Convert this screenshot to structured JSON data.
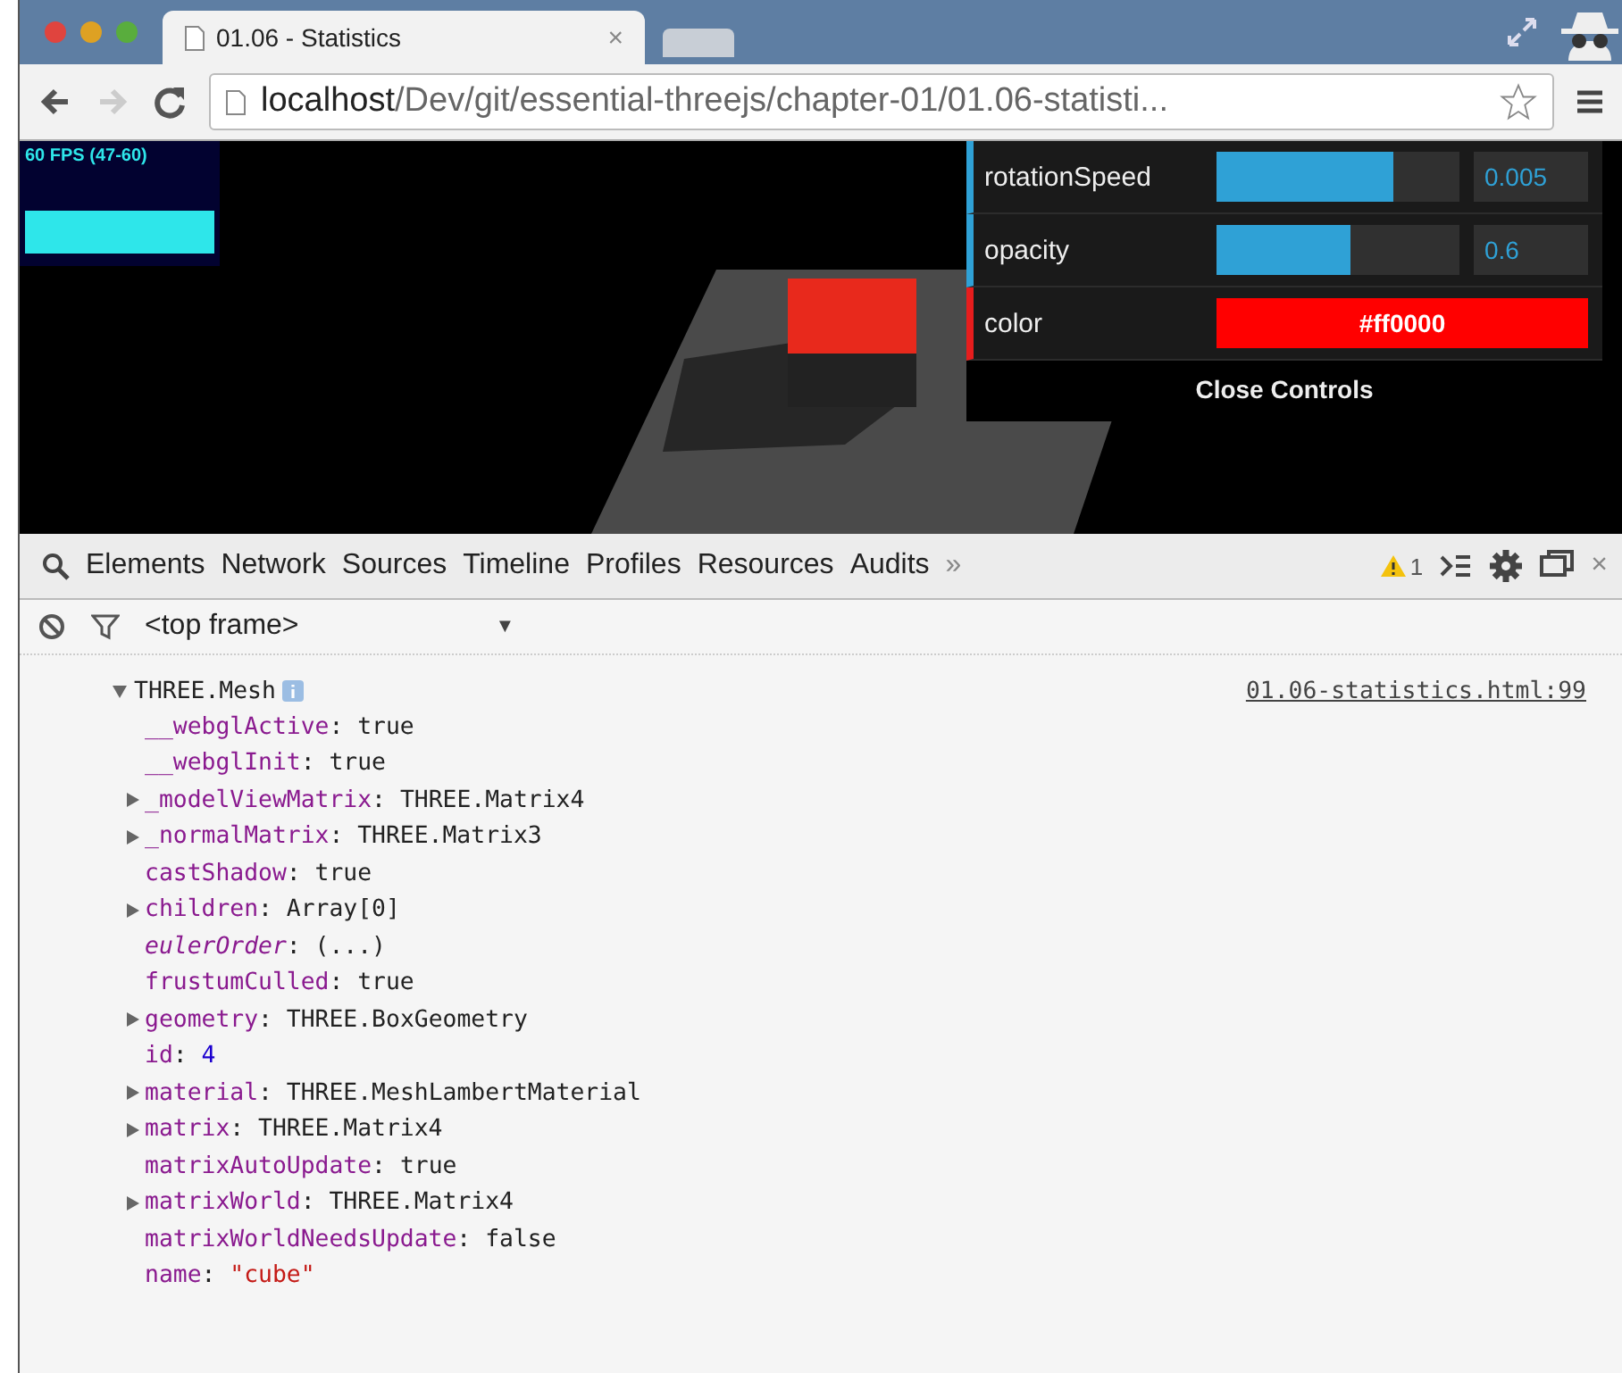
{
  "browser": {
    "tab": {
      "title": "01.06 - Statistics",
      "close": "×"
    },
    "address": {
      "host": "localhost",
      "path": "/Dev/git/essential-threejs/chapter-01/01.06-statisti..."
    }
  },
  "stats": {
    "fps": "60 FPS (47-60)"
  },
  "controls": {
    "rows": [
      {
        "kind": "slider",
        "label": "rotationSpeed",
        "level": 0.73,
        "value": "0.005"
      },
      {
        "kind": "slider",
        "label": "opacity",
        "level": 0.55,
        "value": "0.6"
      },
      {
        "kind": "color",
        "label": "color",
        "value": "#ff0000",
        "color": "#ff0000"
      }
    ],
    "close": "Close Controls"
  },
  "devtools": {
    "tabs": [
      {
        "label": "Elements",
        "selected": false
      },
      {
        "label": "Network",
        "selected": false
      },
      {
        "label": "Sources",
        "selected": false
      },
      {
        "label": "Timeline",
        "selected": false
      },
      {
        "label": "Profiles",
        "selected": false
      },
      {
        "label": "Resources",
        "selected": false
      },
      {
        "label": "Audits",
        "selected": false
      }
    ],
    "more": "»",
    "warnings": "1",
    "close": "×",
    "frame": {
      "label": "<top frame>",
      "arrow": "▼"
    },
    "console": {
      "object": "THREE.Mesh",
      "source": "01.06-statistics.html:99",
      "expanded": true,
      "properties": [
        {
          "name": "__webglActive",
          "separator": ":",
          "value": "true",
          "kind": "plain",
          "expandable": false
        },
        {
          "name": "__webglInit",
          "separator": ":",
          "value": "true",
          "kind": "plain",
          "expandable": false
        },
        {
          "name": "_modelViewMatrix",
          "separator": ":",
          "value": "THREE.Matrix4",
          "kind": "plain",
          "expandable": true
        },
        {
          "name": "_normalMatrix",
          "separator": ":",
          "value": "THREE.Matrix3",
          "kind": "plain",
          "expandable": true
        },
        {
          "name": "castShadow",
          "separator": ":",
          "value": "true",
          "kind": "plain",
          "expandable": false
        },
        {
          "name": "children",
          "separator": ":",
          "value": "Array[0]",
          "kind": "plain",
          "expandable": true
        },
        {
          "name": "eulerOrder",
          "separator": ":",
          "value": "(...)",
          "kind": "getter",
          "expandable": false
        },
        {
          "name": "frustumCulled",
          "separator": ":",
          "value": "true",
          "kind": "plain",
          "expandable": false
        },
        {
          "name": "geometry",
          "separator": ":",
          "value": "THREE.BoxGeometry",
          "kind": "plain",
          "expandable": true
        },
        {
          "name": "id",
          "separator": ":",
          "value": "4",
          "kind": "number",
          "expandable": false
        },
        {
          "name": "material",
          "separator": ":",
          "value": "THREE.MeshLambertMaterial",
          "kind": "plain",
          "expandable": true
        },
        {
          "name": "matrix",
          "separator": ":",
          "value": "THREE.Matrix4",
          "kind": "plain",
          "expandable": true
        },
        {
          "name": "matrixAutoUpdate",
          "separator": ":",
          "value": "true",
          "kind": "plain",
          "expandable": false
        },
        {
          "name": "matrixWorld",
          "separator": ":",
          "value": "THREE.Matrix4",
          "kind": "plain",
          "expandable": true
        },
        {
          "name": "matrixWorldNeedsUpdate",
          "separator": ":",
          "value": "false",
          "kind": "plain",
          "expandable": false
        },
        {
          "name": "name",
          "separator": ":",
          "value": "\"cube\"",
          "kind": "string",
          "expandable": false
        }
      ]
    }
  }
}
